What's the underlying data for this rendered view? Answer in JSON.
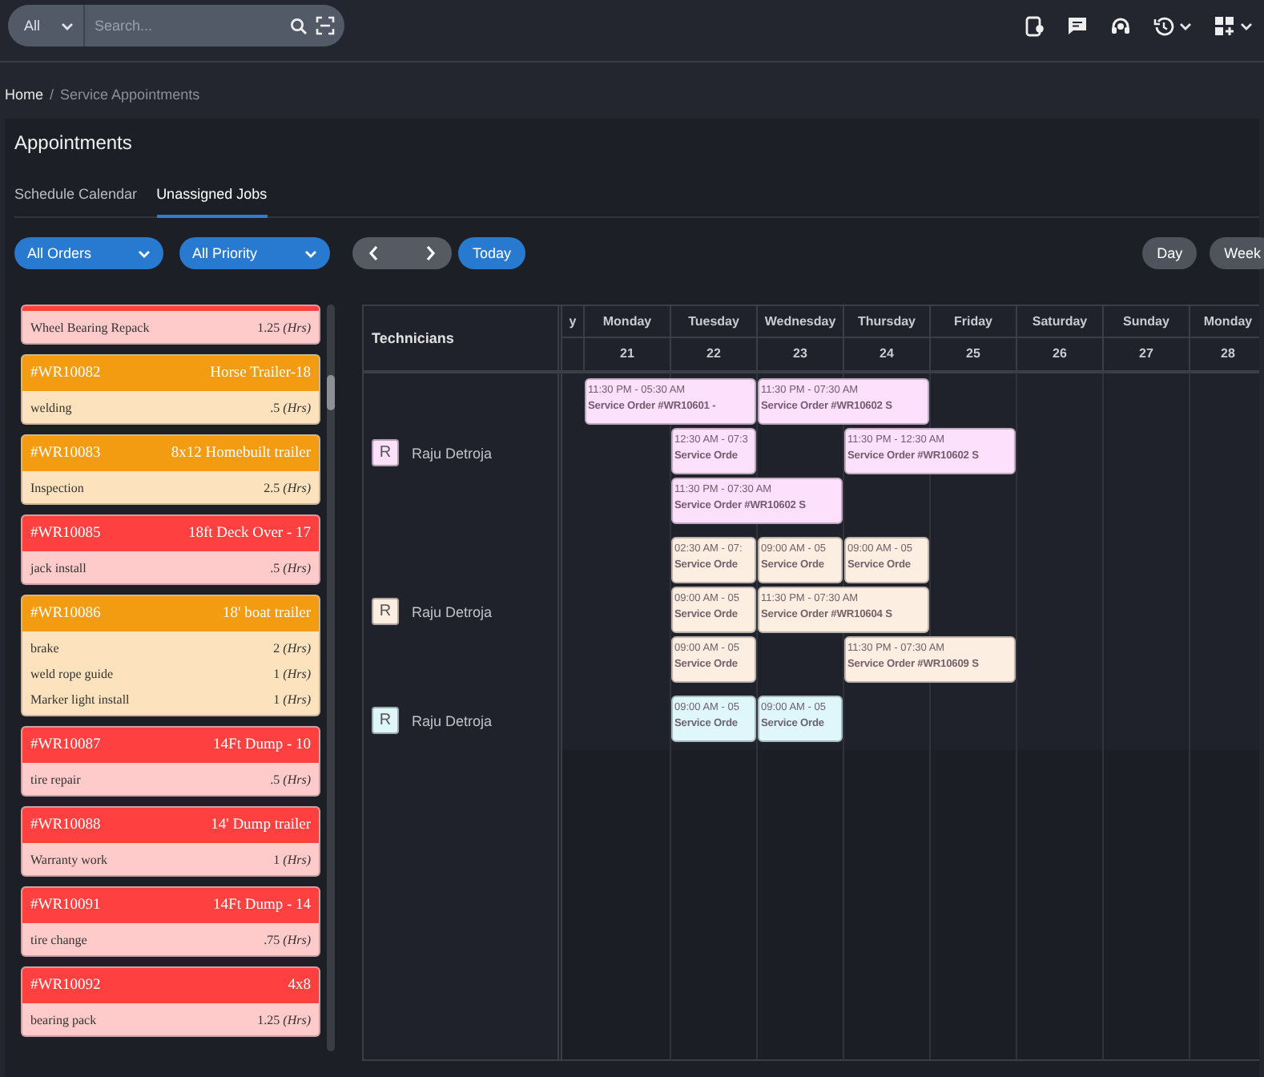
{
  "topbar": {
    "scope": "All",
    "search": {
      "placeholder": "Search..."
    }
  },
  "breadcrumb": {
    "home": "Home",
    "separator": "/",
    "current": "Service Appointments"
  },
  "title": "Appointments",
  "tabs": [
    {
      "label": "Schedule Calendar",
      "selected": false
    },
    {
      "label": "Unassigned Jobs",
      "selected": true
    }
  ],
  "filters": {
    "orders": "All Orders",
    "priority": "All Priority",
    "today": "Today",
    "views": [
      {
        "label": "Day",
        "selected": false
      },
      {
        "label": "Week",
        "selected": false
      }
    ]
  },
  "jobs": [
    {
      "color": "#ff4040",
      "tasks": [
        {
          "name": "Wheel Bearing Repack",
          "hours": "1.25 *(Hrs)*"
        }
      ]
    },
    {
      "id": "#WR10082",
      "title": "Horse Trailer-18",
      "color": "#f39c12",
      "tasks": [
        {
          "name": "welding",
          "hours": ".5 *(Hrs)*"
        }
      ]
    },
    {
      "id": "#WR10083",
      "title": "8x12 Homebuilt trailer",
      "color": "#f39c12",
      "tasks": [
        {
          "name": "Inspection",
          "hours": "2.5 *(Hrs)*"
        }
      ]
    },
    {
      "id": "#WR10085",
      "title": "18ft Deck Over - 17",
      "color": "#ff4040",
      "tasks": [
        {
          "name": "jack install",
          "hours": ".5 *(Hrs)*"
        }
      ]
    },
    {
      "id": "#WR10086",
      "title": "18' boat trailer",
      "color": "#f39c12",
      "tasks": [
        {
          "name": "brake",
          "hours": "2 *(Hrs)*"
        },
        {
          "name": "weld rope guide",
          "hours": "1 *(Hrs)*"
        },
        {
          "name": "Marker light install",
          "hours": "1 *(Hrs)*"
        }
      ]
    },
    {
      "id": "#WR10087",
      "title": "14Ft Dump - 10",
      "color": "#ff4040",
      "tasks": [
        {
          "name": "tire repair",
          "hours": ".5 *(Hrs)*"
        }
      ]
    },
    {
      "id": "#WR10088",
      "title": "14' Dump trailer",
      "color": "#ff4040",
      "tasks": [
        {
          "name": "Warranty work",
          "hours": "1 *(Hrs)*"
        }
      ]
    },
    {
      "id": "#WR10091",
      "title": "14Ft Dump - 14",
      "color": "#ff4040",
      "tasks": [
        {
          "name": "tire change",
          "hours": ".75 *(Hrs)*"
        }
      ]
    },
    {
      "id": "#WR10092",
      "title": "4x8",
      "color": "#ff4040",
      "tasks": [
        {
          "name": "bearing pack",
          "hours": "1.25 *(Hrs)*"
        }
      ]
    }
  ],
  "calendar": {
    "technicians_label": "Technicians",
    "days": [
      {
        "name": "y"
      },
      {
        "name": "Monday",
        "date": "21"
      },
      {
        "name": "Tuesday",
        "date": "22"
      },
      {
        "name": "Wednesday",
        "date": "23"
      },
      {
        "name": "Thursday",
        "date": "24"
      },
      {
        "name": "Friday",
        "date": "25"
      },
      {
        "name": "Saturday",
        "date": "26"
      },
      {
        "name": "Sunday",
        "date": "27"
      },
      {
        "name": "Monday",
        "date": "28"
      }
    ],
    "technicians": [
      {
        "initial": "R",
        "name": "Raju Detroja",
        "color": "#fde0fb",
        "lanes": [
          [
            {
              "kind": "double",
              "time": "11:30 PM - 05:30 AM",
              "title": "Service Order #WR10601 -"
            },
            {
              "kind": "double",
              "time": "11:30 PM - 07:30 AM",
              "title": "Service Order #WR10602 S"
            }
          ],
          [
            {
              "kind": "gap"
            },
            {
              "kind": "single",
              "time": "12:30 AM - 07:3",
              "title": "Service Orde"
            },
            {
              "kind": "gap"
            },
            {
              "kind": "double",
              "time": "11:30 PM - 12:30 AM",
              "title": "Service Order #WR10602 S"
            }
          ],
          [
            {
              "kind": "gap"
            },
            {
              "kind": "double",
              "time": "11:30 PM - 07:30 AM",
              "title": "Service Order #WR10602 S"
            }
          ]
        ]
      },
      {
        "initial": "R",
        "name": "Raju Detroja",
        "color": "#fdeee2",
        "lanes": [
          [
            {
              "kind": "gap"
            },
            {
              "kind": "single",
              "time": "02:30 AM - 07:",
              "title": "Service Orde"
            },
            {
              "kind": "single",
              "time": "09:00 AM - 05",
              "title": "Service Orde"
            },
            {
              "kind": "single",
              "time": "09:00 AM - 05",
              "title": "Service Orde"
            }
          ],
          [
            {
              "kind": "gap"
            },
            {
              "kind": "single",
              "time": "09:00 AM - 05",
              "title": "Service Orde"
            },
            {
              "kind": "double",
              "time": "11:30 PM - 07:30 AM",
              "title": "Service Order #WR10604 S"
            }
          ],
          [
            {
              "kind": "gap"
            },
            {
              "kind": "single",
              "time": "09:00 AM - 05",
              "title": "Service Orde"
            },
            {
              "kind": "gap"
            },
            {
              "kind": "double",
              "time": "11:30 PM - 07:30 AM",
              "title": "Service Order #WR10609 S"
            }
          ]
        ]
      },
      {
        "initial": "R",
        "name": "Raju Detroja",
        "color": "#dff7fb",
        "lanes": [
          [
            {
              "kind": "gap"
            },
            {
              "kind": "single",
              "time": "09:00 AM - 05",
              "title": "Service Orde"
            },
            {
              "kind": "single",
              "time": "09:00 AM - 05",
              "title": "Service Orde"
            }
          ]
        ]
      }
    ]
  }
}
